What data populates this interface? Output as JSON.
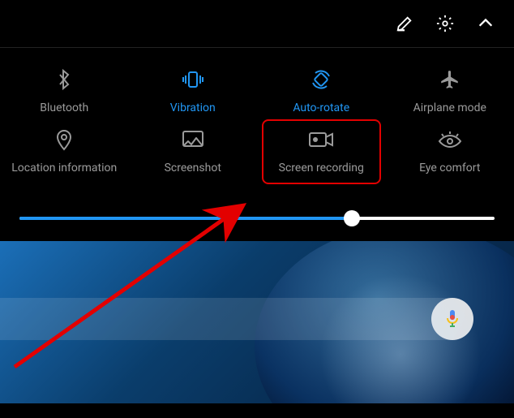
{
  "header": {
    "icons": [
      "edit",
      "settings",
      "expand"
    ]
  },
  "tiles": [
    {
      "id": "bluetooth",
      "label": "Bluetooth",
      "active": false
    },
    {
      "id": "vibration",
      "label": "Vibration",
      "active": true
    },
    {
      "id": "autorotate",
      "label": "Auto-rotate",
      "active": true
    },
    {
      "id": "airplane",
      "label": "Airplane mode",
      "active": false
    },
    {
      "id": "location",
      "label": "Location information",
      "active": false
    },
    {
      "id": "screenshot",
      "label": "Screenshot",
      "active": false
    },
    {
      "id": "screenrecord",
      "label": "Screen recording",
      "active": false,
      "highlighted": true
    },
    {
      "id": "eyecomfort",
      "label": "Eye comfort",
      "active": false
    }
  ],
  "brightness": {
    "value_pct": 70
  },
  "colors": {
    "active": "#2196f3",
    "inactive": "#9a9a9a",
    "highlight": "#e30000"
  },
  "annotation": {
    "type": "arrow",
    "target": "screen-recording-tile"
  }
}
